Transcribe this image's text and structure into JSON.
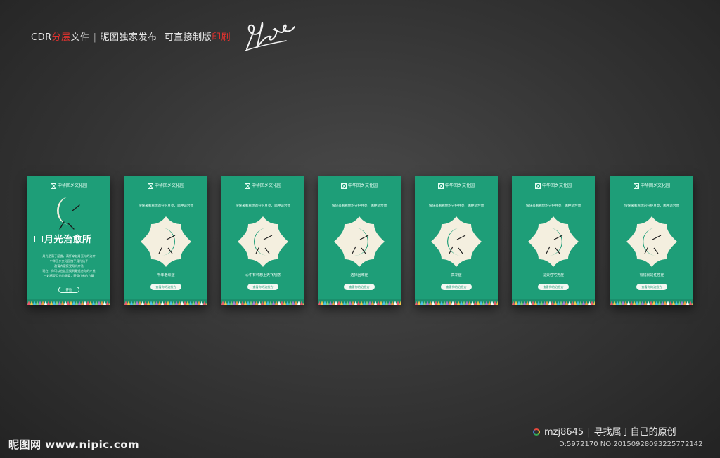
{
  "header": {
    "part1": "CDR",
    "part2_red": "分层",
    "part3": "文件",
    "sep": "|",
    "part4": "昵图独家发布",
    "part5": "可直接制版",
    "part6_red": "印刷"
  },
  "colors": {
    "card_green": "#1e9e78",
    "cream": "#f4efdf",
    "highlight_red": "#e0322f"
  },
  "brand": "中华回乡文化园",
  "intro": {
    "title": "月光治愈所",
    "lines": [
      "月光洒落于屋檐，满怀穿越月亮光的治疗",
      "中华回乡文化园携手月光仙子",
      "邀请大家接受月光疗法",
      "现在，你可以在这里找到最适合你的疗愈",
      "一起感受月光的温柔，获得疗愈的力量"
    ],
    "start_label": "开始"
  },
  "cards": [
    {
      "subtitle": "快快来看看你的守护月亮，哪种适合你",
      "result": "千年老顽症",
      "button": "查看你的治愈方"
    },
    {
      "subtitle": "快快来看看你的守护月亮，哪种适合你",
      "result": "心中有种想上天飞翔感",
      "button": "查看你的治愈方"
    },
    {
      "subtitle": "快快来看看你的守护月亮，哪种适合你",
      "result": "选择困难症",
      "button": "查看你的治愈方"
    },
    {
      "subtitle": "快快来看看你的守护月亮，哪种适合你",
      "result": "高冷症",
      "button": "查看你的治愈方"
    },
    {
      "subtitle": "快快来看看你的守护月亮，哪种适合你",
      "result": "是天性宅男症",
      "button": "查看你的治愈方"
    },
    {
      "subtitle": "快快来看看你的守护月亮，哪种适合你",
      "result": "有钱就是任性症",
      "button": "查看你的治愈方"
    }
  ],
  "footer": {
    "author": "mzj8645",
    "sep": "|",
    "slogan": "寻找属于自己的原创",
    "id": "ID:5972170 NO:20150928093225772142",
    "watermark": "昵图网 www.nipic.com"
  }
}
